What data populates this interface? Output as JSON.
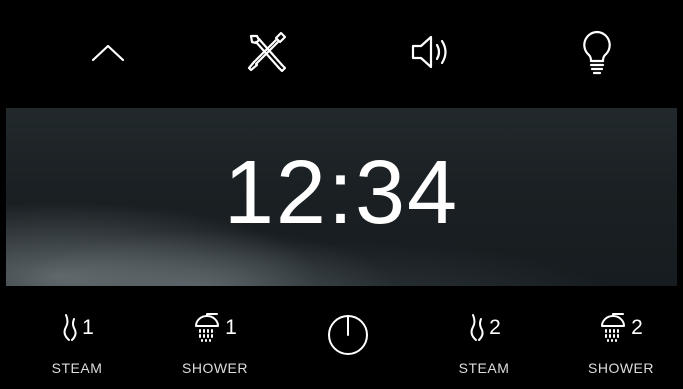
{
  "top_toolbar": {
    "icons": [
      "chevron-up-icon",
      "tools-icon",
      "volume-icon",
      "light-bulb-icon"
    ]
  },
  "clock": {
    "time": "12:34"
  },
  "bottom_bar": {
    "controls": [
      {
        "icon": "steam-icon",
        "number": "1",
        "label": "STEAM"
      },
      {
        "icon": "shower-icon",
        "number": "1",
        "label": "SHOWER"
      },
      {
        "icon": "steam-icon",
        "number": "2",
        "label": "STEAM"
      },
      {
        "icon": "shower-icon",
        "number": "2",
        "label": "SHOWER"
      }
    ],
    "power_icon": "power-icon"
  },
  "colors": {
    "background": "#000000",
    "foreground": "#ffffff",
    "banner": "#1a2023"
  }
}
